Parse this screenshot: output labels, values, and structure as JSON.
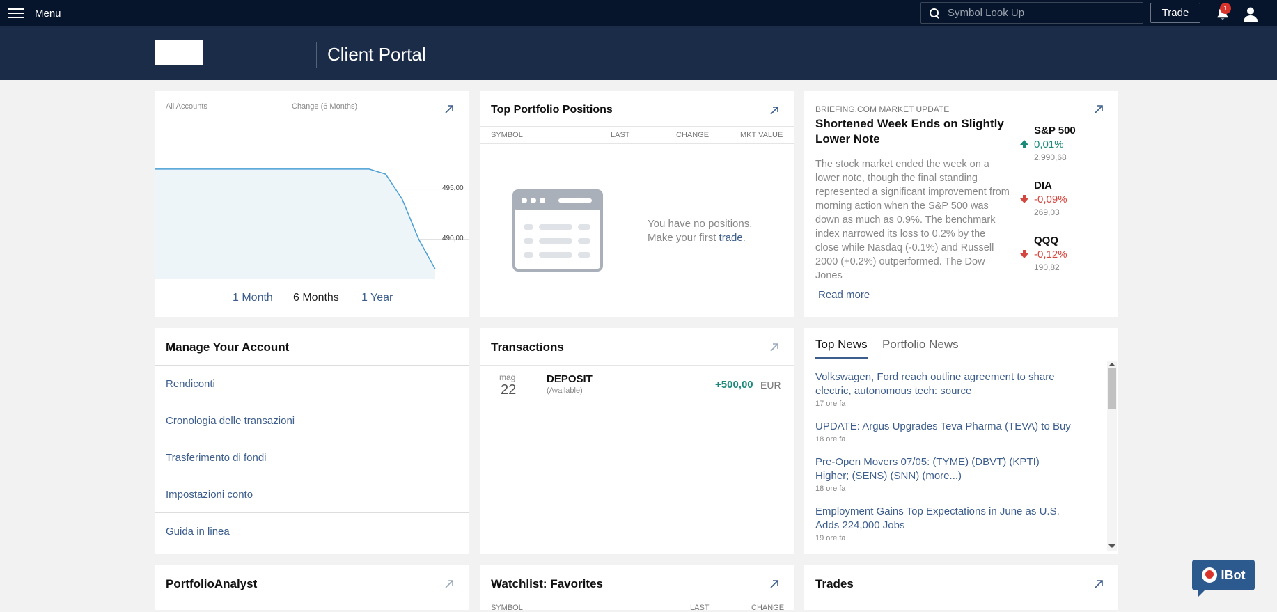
{
  "topbar": {
    "menu_label": "Menu",
    "search_placeholder": "Symbol Look Up",
    "trade_label": "Trade",
    "notification_count": "1"
  },
  "header": {
    "title": "Client Portal"
  },
  "account_chart": {
    "accounts_label": "All Accounts",
    "change_label": "Change (6 Months)",
    "ticks": [
      "495,00",
      "490,00"
    ],
    "periods": [
      "1 Month",
      "6 Months",
      "1 Year"
    ],
    "selected_period": "6 Months",
    "chart_data": {
      "type": "area",
      "ylim": [
        486,
        502
      ],
      "yticks": [
        495,
        490
      ],
      "values": [
        497,
        497,
        497,
        497,
        497,
        497,
        497,
        497,
        497,
        497,
        497,
        497,
        497,
        497,
        496.5,
        494,
        490,
        487
      ]
    }
  },
  "positions": {
    "title": "Top Portfolio Positions",
    "columns": [
      "SYMBOL",
      "LAST",
      "CHANGE",
      "MKT VALUE"
    ],
    "empty_line1": "You have no positions.",
    "empty_line2_prefix": "Make your first ",
    "empty_link": "trade",
    "empty_line2_suffix": "."
  },
  "market": {
    "source": "BRIEFING.COM MARKET UPDATE",
    "headline": "Shortened Week Ends on Slightly Lower Note",
    "body": "The stock market ended the week on a lower note, though the final standing represented a significant improvement from morning action when the S&P 500 was down as much as 0.9%. The benchmark index narrowed its loss to 0.2% by the close while Nasdaq (-0.1%) and Russell 2000 (+0.2%) outperformed. The Dow Jones",
    "read_more": "Read more",
    "tickers": [
      {
        "name": "S&P 500",
        "change": "0,01%",
        "value": "2.990,68",
        "direction": "up"
      },
      {
        "name": "DIA",
        "change": "-0,09%",
        "value": "269,03",
        "direction": "down"
      },
      {
        "name": "QQQ",
        "change": "-0,12%",
        "value": "190,82",
        "direction": "down"
      }
    ]
  },
  "manage": {
    "title": "Manage Your Account",
    "items": [
      "Rendiconti",
      "Cronologia delle transazioni",
      "Trasferimento di fondi",
      "Impostazioni conto",
      "Guida in linea"
    ]
  },
  "transactions": {
    "title": "Transactions",
    "rows": [
      {
        "month": "mag",
        "day": "22",
        "type": "DEPOSIT",
        "status": "(Available)",
        "amount": "+500,00",
        "currency": "EUR"
      }
    ]
  },
  "news": {
    "tabs": [
      "Top News",
      "Portfolio News"
    ],
    "active_tab": "Top News",
    "items": [
      {
        "headline": "Volkswagen, Ford reach outline agreement to share electric, autonomous tech: source",
        "time": "17 ore fa"
      },
      {
        "headline": "UPDATE: Argus Upgrades Teva Pharma (TEVA) to Buy",
        "time": "18 ore fa"
      },
      {
        "headline": "Pre-Open Movers 07/05: (TYME) (DBVT) (KPTI) Higher; (SENS) (SNN) (more...)",
        "time": "18 ore fa"
      },
      {
        "headline": "Employment Gains Top Expectations in June as U.S. Adds 224,000 Jobs",
        "time": "19 ore fa"
      }
    ]
  },
  "bottom": {
    "portfolio_analyst": "PortfolioAnalyst",
    "watchlist": "Watchlist: Favorites",
    "watchlist_columns": [
      "SYMBOL",
      "LAST",
      "CHANGE"
    ],
    "trades": "Trades"
  },
  "ibot": {
    "label": "IBot"
  },
  "colors": {
    "navy": "#06152b",
    "header": "#1b2c48",
    "link": "#3d5e8c",
    "up": "#1a8a7a",
    "down": "#d4473f"
  }
}
